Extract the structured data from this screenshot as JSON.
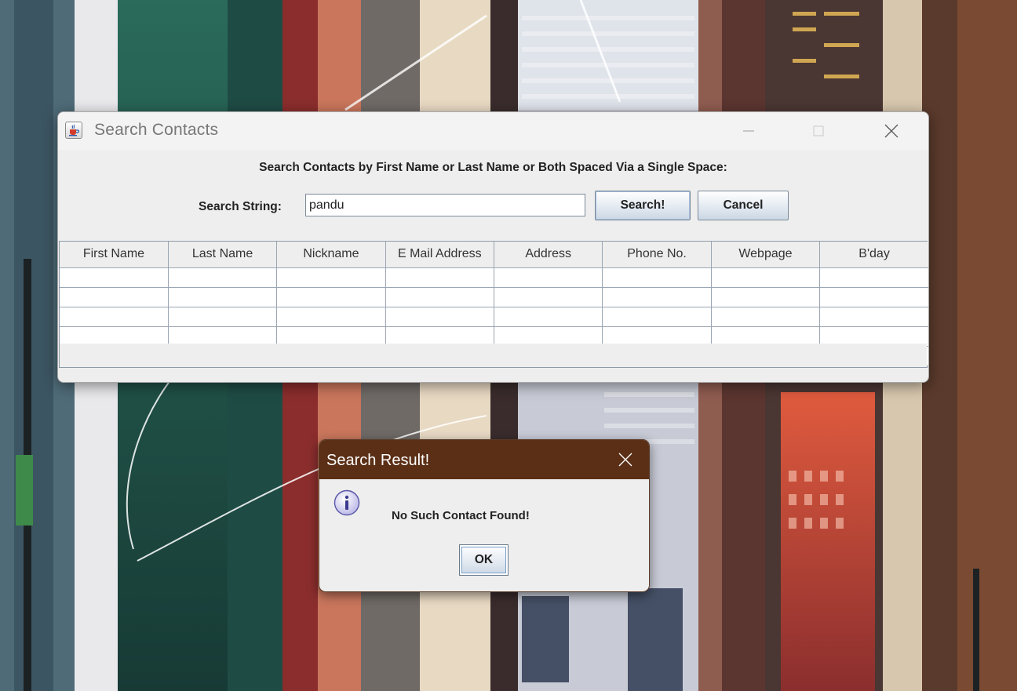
{
  "main_window": {
    "title": "Search Contacts",
    "heading": "Search Contacts by First Name or Last Name or Both Spaced Via a Single Space:",
    "search_label": "Search String:",
    "search_value": "pandu",
    "search_button": "Search!",
    "cancel_button": "Cancel",
    "table": {
      "columns": [
        "First Name",
        "Last Name",
        "Nickname",
        "E Mail Address",
        "Address",
        "Phone No.",
        "Webpage",
        "B'day"
      ],
      "rows": [
        [
          "",
          "",
          "",
          "",
          "",
          "",
          "",
          ""
        ],
        [
          "",
          "",
          "",
          "",
          "",
          "",
          "",
          ""
        ],
        [
          "",
          "",
          "",
          "",
          "",
          "",
          "",
          ""
        ],
        [
          "",
          "",
          "",
          "",
          "",
          "",
          "",
          ""
        ],
        [
          "",
          "",
          "",
          "",
          "",
          "",
          "",
          ""
        ]
      ]
    }
  },
  "dialog": {
    "title": "Search Result!",
    "message": "No Such Contact Found!",
    "ok_button": "OK"
  },
  "icons": {
    "app": "java-cup-icon",
    "minimize": "minimize-icon",
    "maximize": "maximize-icon",
    "close": "close-icon",
    "info": "info-icon"
  },
  "colors": {
    "dialog_titlebar": "#5b2f16",
    "window_background": "#eeeeee",
    "grid_lines": "#9aa6b3"
  }
}
